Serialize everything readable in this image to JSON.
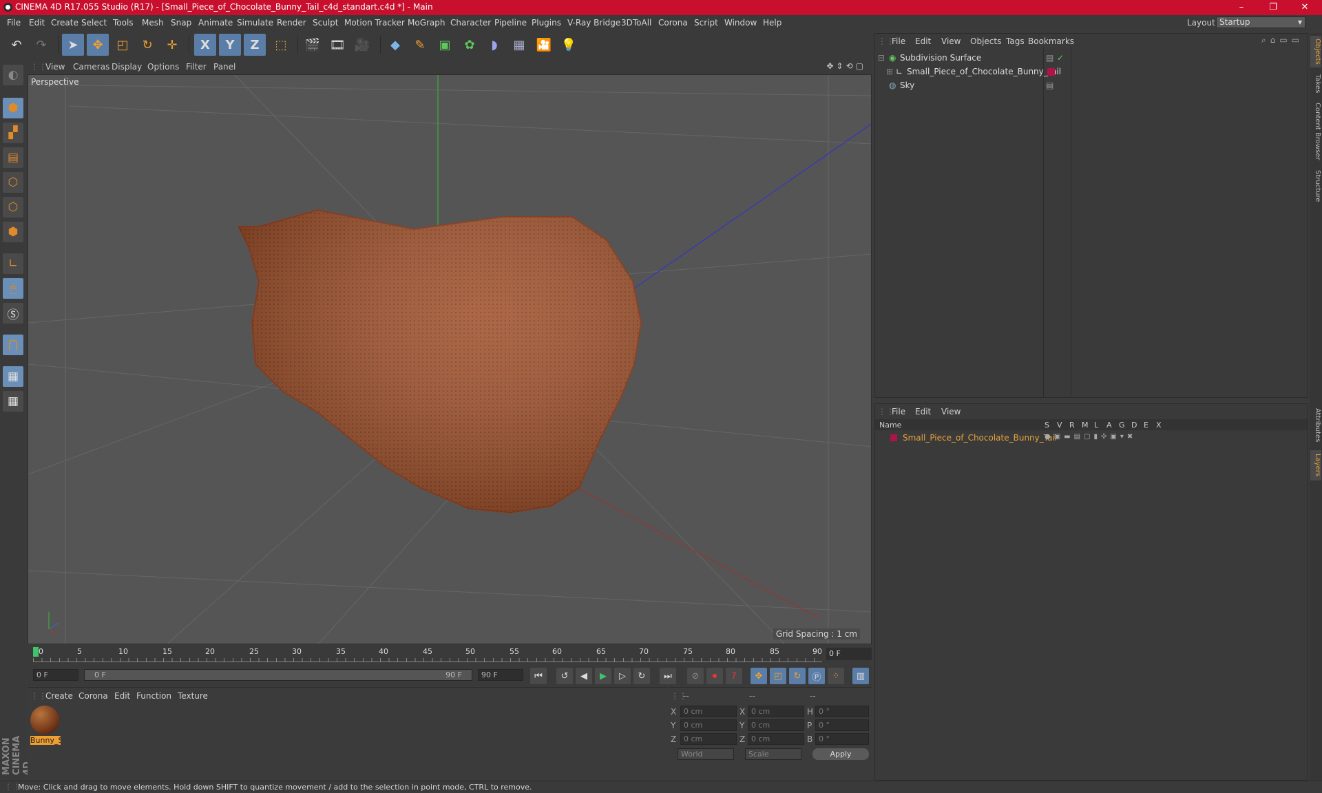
{
  "window": {
    "title": "CINEMA 4D R17.055 Studio (R17) - [Small_Piece_of_Chocolate_Bunny_Tail_c4d_standart.c4d *] - Main",
    "minimize": "–",
    "maximize": "❐",
    "close": "✕"
  },
  "menu": [
    "File",
    "Edit",
    "Create",
    "Select",
    "Tools",
    "Mesh",
    "Snap",
    "Animate",
    "Simulate",
    "Render",
    "Sculpt",
    "Motion Tracker",
    "MoGraph",
    "Character",
    "Pipeline",
    "Plugins",
    "V-Ray Bridge",
    "3DToAll",
    "Corona",
    "Script",
    "Window",
    "Help"
  ],
  "layout": {
    "label": "Layout:",
    "value": "Startup"
  },
  "toolbar": {
    "axis_x": "X",
    "axis_y": "Y",
    "axis_z": "Z"
  },
  "viewport": {
    "menu": [
      "View",
      "Cameras",
      "Display",
      "Options",
      "Filter",
      "Panel"
    ],
    "label": "Perspective",
    "grid_spacing": "Grid Spacing : 1 cm"
  },
  "timeline": {
    "ticks": [
      "0",
      "5",
      "10",
      "15",
      "20",
      "25",
      "30",
      "35",
      "40",
      "45",
      "50",
      "55",
      "60",
      "65",
      "70",
      "75",
      "80",
      "85",
      "90"
    ],
    "current_frame": "0 F"
  },
  "transport": {
    "start_field": "0 F",
    "range_start": "0 F",
    "range_end": "90 F",
    "end_field": "90 F"
  },
  "materials": {
    "menu": [
      "Create",
      "Corona",
      "Edit",
      "Function",
      "Texture"
    ],
    "items": [
      {
        "name": "Bunny_S"
      }
    ]
  },
  "coords": {
    "header": [
      "--",
      "--",
      "--"
    ],
    "rows": [
      {
        "a": "X",
        "av": "0 cm",
        "b": "X",
        "bv": "0 cm",
        "c": "H",
        "cv": "0 °"
      },
      {
        "a": "Y",
        "av": "0 cm",
        "b": "Y",
        "bv": "0 cm",
        "c": "P",
        "cv": "0 °"
      },
      {
        "a": "Z",
        "av": "0 cm",
        "b": "Z",
        "bv": "0 cm",
        "c": "B",
        "cv": "0 °"
      }
    ],
    "space": "World",
    "mode": "Scale",
    "apply": "Apply"
  },
  "objects": {
    "menu": [
      "File",
      "Edit",
      "View",
      "Objects",
      "Tags",
      "Bookmarks"
    ],
    "items": [
      {
        "name": "Subdivision Surface"
      },
      {
        "name": "Small_Piece_of_Chocolate_Bunny_Tail"
      },
      {
        "name": "Sky"
      }
    ]
  },
  "layers": {
    "menu": [
      "File",
      "Edit",
      "View"
    ],
    "header_name": "Name",
    "columns": [
      "S",
      "V",
      "R",
      "M",
      "L",
      "A",
      "G",
      "D",
      "E",
      "X"
    ],
    "items": [
      {
        "name": "Small_Piece_of_Chocolate_Bunny_Tail"
      }
    ]
  },
  "right_tabs": [
    "Objects",
    "Takes",
    "Content Browser",
    "Structure",
    "Attributes",
    "Layers"
  ],
  "status": "Move: Click and drag to move elements. Hold down SHIFT to quantize movement / add to the selection in point mode, CTRL to remove.",
  "brand": "MAXON CINEMA 4D",
  "colors": {
    "accent": "#c8102e",
    "highlight": "#5a7ea8",
    "object": "#a0522d",
    "layer_text": "#e8a13a"
  }
}
